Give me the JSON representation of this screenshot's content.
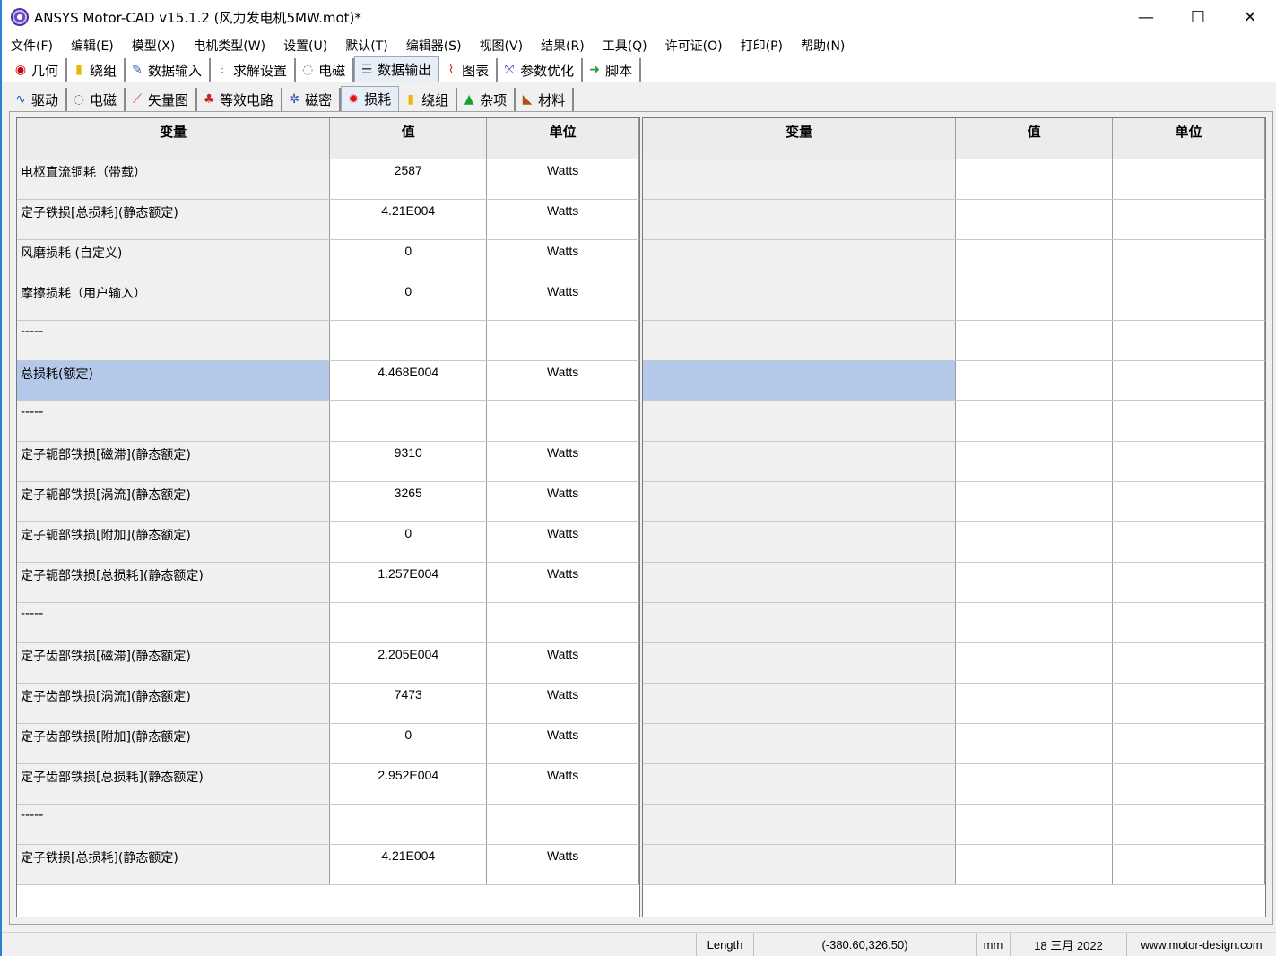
{
  "window": {
    "title": "ANSYS Motor-CAD v15.1.2 (风力发电机5MW.mot)*",
    "minimize_glyph": "—",
    "maximize_glyph": "☐",
    "close_glyph": "✕"
  },
  "menu": [
    "文件(F)",
    "编辑(E)",
    "模型(X)",
    "电机类型(W)",
    "设置(U)",
    "默认(T)",
    "编辑器(S)",
    "视图(V)",
    "结果(R)",
    "工具(Q)",
    "许可证(O)",
    "打印(P)",
    "帮助(N)"
  ],
  "main_tabs": [
    {
      "label": "几何",
      "icon": "geometry-icon",
      "glyph": "◉",
      "color": "#cc0000"
    },
    {
      "label": "绕组",
      "icon": "winding-icon",
      "glyph": "▮",
      "color": "#e8b800"
    },
    {
      "label": "数据输入",
      "icon": "data-input-icon",
      "glyph": "✎",
      "color": "#3b5bb0"
    },
    {
      "label": "求解设置",
      "icon": "solver-settings-icon",
      "glyph": "⫶",
      "color": "#2b5fd0"
    },
    {
      "label": "电磁",
      "icon": "electromagnetic-icon",
      "glyph": "◌",
      "color": "#5a6a8a"
    },
    {
      "label": "数据输出",
      "icon": "data-output-icon",
      "glyph": "☰",
      "color": "#333333",
      "active": true
    },
    {
      "label": "图表",
      "icon": "chart-icon",
      "glyph": "⌇",
      "color": "#c03030"
    },
    {
      "label": "参数优化",
      "icon": "optimization-icon",
      "glyph": "⤧",
      "color": "#5050c0"
    },
    {
      "label": "脚本",
      "icon": "script-icon",
      "glyph": "➜",
      "color": "#1a9e3a"
    }
  ],
  "sub_tabs": [
    {
      "label": "驱动",
      "icon": "drive-icon",
      "glyph": "∿",
      "color": "#2060c0"
    },
    {
      "label": "电磁",
      "icon": "electromagnetic-icon",
      "glyph": "◌",
      "color": "#5a6a8a"
    },
    {
      "label": "矢量图",
      "icon": "vector-diagram-icon",
      "glyph": "⟋",
      "color": "#c03030"
    },
    {
      "label": "等效电路",
      "icon": "equivalent-circuit-icon",
      "glyph": "♣",
      "color": "#d02020"
    },
    {
      "label": "磁密",
      "icon": "flux-density-icon",
      "glyph": "✲",
      "color": "#3050b0"
    },
    {
      "label": "损耗",
      "icon": "losses-icon",
      "glyph": "✹",
      "color": "#e01010",
      "active": true
    },
    {
      "label": "绕组",
      "icon": "winding-icon",
      "glyph": "▮",
      "color": "#e8b800"
    },
    {
      "label": "杂项",
      "icon": "misc-icon",
      "glyph": "▲",
      "color": "#18a030"
    },
    {
      "label": "材料",
      "icon": "materials-icon",
      "glyph": "◣",
      "color": "#b05020"
    }
  ],
  "table": {
    "headers": [
      "变量",
      "值",
      "单位"
    ],
    "rows": [
      {
        "var": "电枢直流铜耗（带载）",
        "val": "2587",
        "unit": "Watts"
      },
      {
        "var": "定子铁损[总损耗](静态额定)",
        "val": "4.21E004",
        "unit": "Watts"
      },
      {
        "var": "风磨损耗 (自定义)",
        "val": "0",
        "unit": "Watts"
      },
      {
        "var": "摩擦损耗（用户输入）",
        "val": "0",
        "unit": "Watts"
      },
      {
        "var": "-----",
        "val": "",
        "unit": ""
      },
      {
        "var": "总损耗(额定)",
        "val": "4.468E004",
        "unit": "Watts",
        "selected": true
      },
      {
        "var": "-----",
        "val": "",
        "unit": ""
      },
      {
        "var": "定子轭部铁损[磁滞](静态额定)",
        "val": "9310",
        "unit": "Watts"
      },
      {
        "var": "定子轭部铁损[涡流](静态额定)",
        "val": "3265",
        "unit": "Watts"
      },
      {
        "var": "定子轭部铁损[附加](静态额定)",
        "val": "0",
        "unit": "Watts"
      },
      {
        "var": "定子轭部铁损[总损耗](静态额定)",
        "val": "1.257E004",
        "unit": "Watts"
      },
      {
        "var": "-----",
        "val": "",
        "unit": ""
      },
      {
        "var": "定子齿部铁损[磁滞](静态额定)",
        "val": "2.205E004",
        "unit": "Watts"
      },
      {
        "var": "定子齿部铁损[涡流](静态额定)",
        "val": "7473",
        "unit": "Watts"
      },
      {
        "var": "定子齿部铁损[附加](静态额定)",
        "val": "0",
        "unit": "Watts"
      },
      {
        "var": "定子齿部铁损[总损耗](静态额定)",
        "val": "2.952E004",
        "unit": "Watts"
      },
      {
        "var": "-----",
        "val": "",
        "unit": ""
      },
      {
        "var": "定子铁损[总损耗](静态额定)",
        "val": "4.21E004",
        "unit": "Watts"
      }
    ],
    "right_selected_row": 5
  },
  "status": {
    "field": "Length",
    "coords": "(-380.60,326.50)",
    "unit": "mm",
    "date": "18 三月 2022",
    "website": "www.motor-design.com"
  }
}
